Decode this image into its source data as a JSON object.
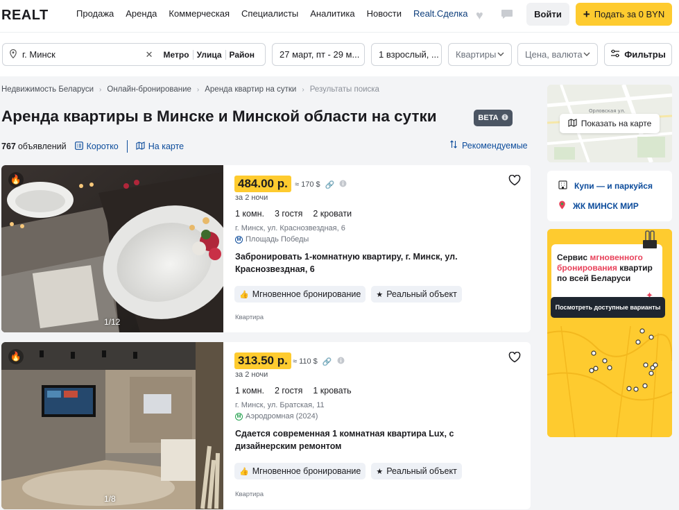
{
  "header": {
    "logo": "REALT",
    "nav": [
      "Продажа",
      "Аренда",
      "Коммерческая",
      "Специалисты",
      "Аналитика",
      "Новости",
      "Realt.Сделка"
    ],
    "login": "Войти",
    "post": "Подать за 0 BYN"
  },
  "search": {
    "city": "г. Минск",
    "opts": [
      "Метро",
      "Улица",
      "Район"
    ],
    "dates": "27 март, пт - 29 м...",
    "guests": "1 взрослый, ...",
    "type_placeholder": "Квартиры",
    "price_placeholder": "Цена, валюта",
    "filters": "Фильтры"
  },
  "breadcrumbs": [
    "Недвижимость Беларуси",
    "Онлайн-бронирование",
    "Аренда квартир на сутки",
    "Результаты поиска"
  ],
  "page": {
    "title": "Аренда квартиры в Минске и Минской области на сутки",
    "beta": "BETA",
    "count_number": "767",
    "count_label": "объявлений",
    "view_short": "Коротко",
    "view_map": "На карте",
    "sort": "Рекомендуемые"
  },
  "listings": [
    {
      "price": "484.00 р.",
      "usd": "≈ 170 $",
      "nights": "за 2 ночи",
      "rooms": "1 комн.",
      "guests": "3 гостя",
      "beds": "2 кровати",
      "address": "г. Минск, ул. Краснозвездная, 6",
      "metro": "Площадь Победы",
      "description": "Забронировать 1-комнатную квартиру, г. Минск, ул. Краснозвездная, 6",
      "badge1": "Мгновенное бронирование",
      "badge2": "Реальный объект",
      "kind": "Квартира",
      "photo_counter": "1/12"
    },
    {
      "price": "313.50 р.",
      "usd": "≈ 110 $",
      "nights": "за 2 ночи",
      "rooms": "1 комн.",
      "guests": "2 гостя",
      "beds": "1 кровать",
      "address": "г. Минск, ул. Братская, 11",
      "metro": "Аэродромная (2024)",
      "description": "Сдается современная 1 комнатная квартира Lux, с дизайнерским ремонтом",
      "badge1": "Мгновенное бронирование",
      "badge2": "Реальный объект",
      "kind": "Квартира",
      "photo_counter": "1/8"
    }
  ],
  "sidebar": {
    "map_button": "Показать на карте",
    "map_streets": [
      "Орловская ул."
    ],
    "link1": "Купи — и паркуйся",
    "link2": "ЖК МИНСК МИР",
    "promo_pre": "Сервис ",
    "promo_hl": "мгновенного бронирования",
    "promo_post": " квартир по всей Беларуси",
    "promo_button": "Посмотреть доступные варианты"
  },
  "colors": {
    "accent_yellow": "#fecb2f",
    "link_blue": "#0b4b9b",
    "promo_highlight": "#e8415a"
  }
}
